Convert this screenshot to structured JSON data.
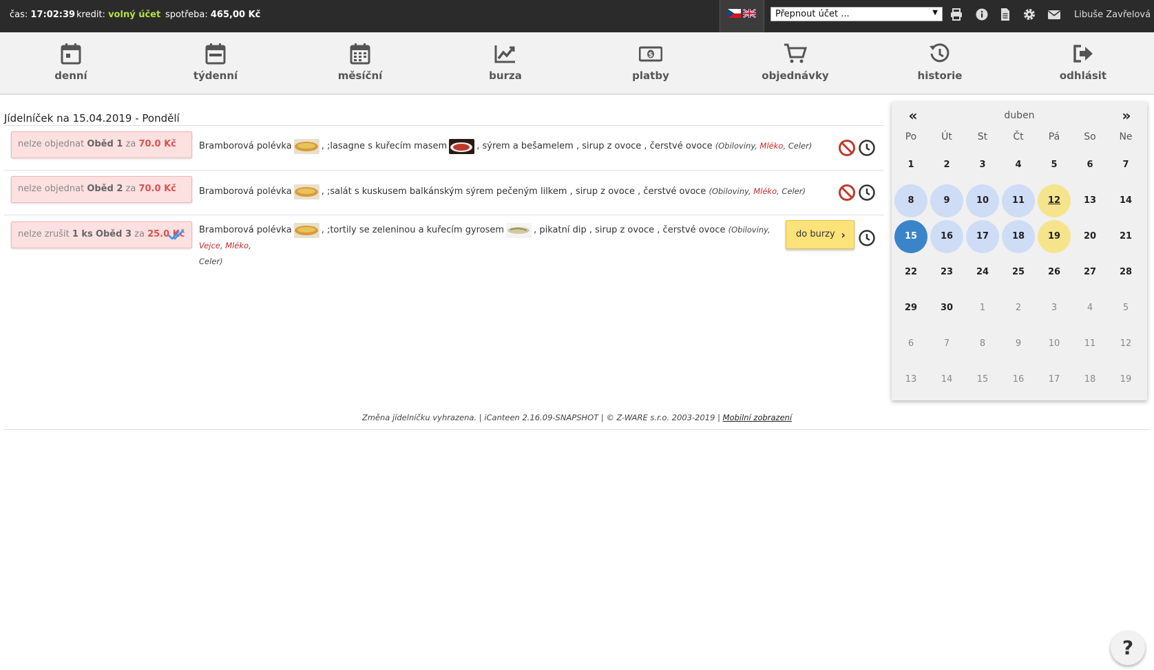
{
  "topbar": {
    "time_label": "čas:",
    "time_value": "17:02:39",
    "credit_label": "kredit:",
    "credit_value": "volný účet",
    "consumption_label": "spotřeba:",
    "consumption_value": "465,00 Kč",
    "switch_account_value": "Přepnout účet ...",
    "user_name": "Libuše Zavřelová"
  },
  "nav": [
    {
      "label": "denní",
      "icon": "calendar-day-icon"
    },
    {
      "label": "týdenní",
      "icon": "calendar-week-icon"
    },
    {
      "label": "měsíční",
      "icon": "calendar-month-icon"
    },
    {
      "label": "burza",
      "icon": "chart-line-icon"
    },
    {
      "label": "platby",
      "icon": "money-icon"
    },
    {
      "label": "objednávky",
      "icon": "cart-icon"
    },
    {
      "label": "historie",
      "icon": "history-icon"
    },
    {
      "label": "odhlásit",
      "icon": "logout-icon"
    }
  ],
  "menu": {
    "title": "Jídelníček na 15.04.2019 - Pondělí",
    "rows": [
      {
        "status": "nelze objednat",
        "qty": "",
        "meal": "Oběd 1",
        "za": "za",
        "price": "70.0 Kč",
        "part1": "Bramborová polévka",
        "part2": ", ;lasagne s kuřecím masem",
        "part3": ", sýrem a bešamelem , sirup z ovoce , čerstvé ovoce",
        "allergen_open": "(Obiloviny, ",
        "allergen_hl": "Mléko",
        "allergen_close": ", Celer)"
      },
      {
        "status": "nelze objednat",
        "qty": "",
        "meal": "Oběd 2",
        "za": "za",
        "price": "70.0 Kč",
        "part1": "Bramborová polévka",
        "part2": ", ;salát s kuskusem balkánským sýrem pečeným lilkem , sirup z ovoce , čerstvé ovoce",
        "allergen_open": "(Obiloviny, ",
        "allergen_hl": "Mléko",
        "allergen_close": ", Celer)"
      },
      {
        "status": "nelze zrušit",
        "qty": "1 ks",
        "meal": "Oběd 3",
        "za": "za",
        "price": "25.0 Kč",
        "part1": "Bramborová polévka",
        "part2": ", ;tortily se zeleninou a kuřecím gyrosem",
        "part3": ", pikatní dip , sirup z ovoce , čerstvé ovoce",
        "allergen_open": "(Obiloviny, ",
        "allergen_hl1": "Vejce",
        "allergen_sep": ", ",
        "allergen_hl2": "Mléko",
        "allergen_close": ",",
        "allergen_line2": "Celer)",
        "burza_label": "do burzy"
      }
    ]
  },
  "calendar": {
    "month": "duben",
    "weekdays": [
      "Po",
      "Út",
      "St",
      "Čt",
      "Pá",
      "So",
      "Ne"
    ],
    "weeks": [
      [
        "1",
        "2",
        "3",
        "4",
        "5",
        "6",
        "7"
      ],
      [
        "8",
        "9",
        "10",
        "11",
        "12",
        "13",
        "14"
      ],
      [
        "15",
        "16",
        "17",
        "18",
        "19",
        "20",
        "21"
      ],
      [
        "22",
        "23",
        "24",
        "25",
        "26",
        "27",
        "28"
      ],
      [
        "29",
        "30",
        "1",
        "2",
        "3",
        "4",
        "5"
      ],
      [
        "6",
        "7",
        "8",
        "9",
        "10",
        "11",
        "12"
      ],
      [
        "13",
        "14",
        "15",
        "16",
        "17",
        "18",
        "19"
      ]
    ]
  },
  "footer": {
    "text": "Změna jídelníčku vyhrazena. | iCanteen 2.16.09-SNAPSHOT | © Z-WARE s.r.o. 2003-2019 | ",
    "mobile_link": "Mobilní zobrazení"
  },
  "help_label": "?",
  "colors": {
    "topbar_bg": "#2b2b2b",
    "credit_green": "#b6e33d",
    "order_disabled_bg": "#fde0e0",
    "price_red": "#d9534f",
    "calendar_selected": "#3a84c9",
    "calendar_ordered": "#cfdcf6",
    "calendar_special": "#f6e48c",
    "burza_yellow": "#fbe37a"
  }
}
